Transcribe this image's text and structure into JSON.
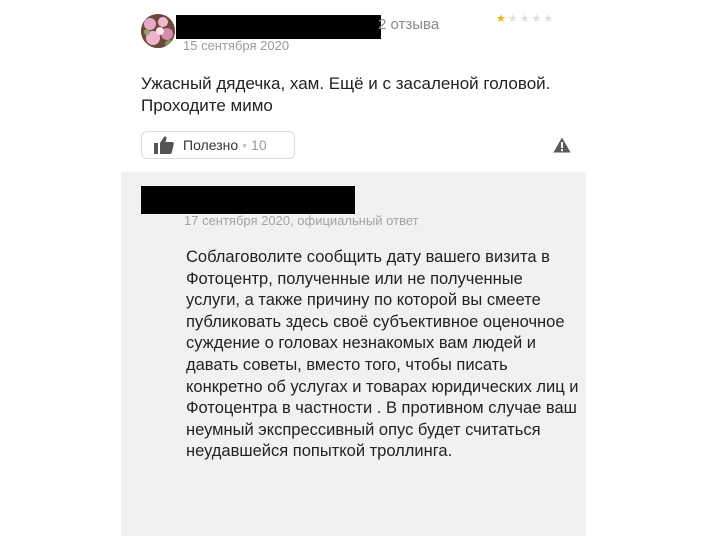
{
  "review": {
    "author_reviews": "2 отзыва",
    "date": "15 сентября 2020",
    "rating": 1,
    "rating_max": 5,
    "text": "Ужасный дядечка, хам. Ещё и с засаленой головой. Проходите мимо",
    "helpful_label": "Полезно",
    "helpful_separator": "•",
    "helpful_count": "10",
    "colors": {
      "star_filled": "#f5b400",
      "star_empty": "#dedede"
    }
  },
  "reply": {
    "meta": "17 сентября 2020, официальный ответ",
    "text": "Соблаговолите сообщить дату вашего визита в Фотоцентр, полученные или не полученные услуги, а также причину по которой вы смеете публиковать здесь своё субъективное оценочное суждение о головах незнакомых вам людей и давать советы, вместо того, чтобы писать конкретно об услугах и товарах юридических лиц и Фотоцентра в частности . В противном случае ваш неумный экспрессивный опус будет считаться неудавшейся попыткой троллинга."
  },
  "icons": {
    "helpful": "thumbs-up-icon",
    "report": "warning-icon"
  }
}
